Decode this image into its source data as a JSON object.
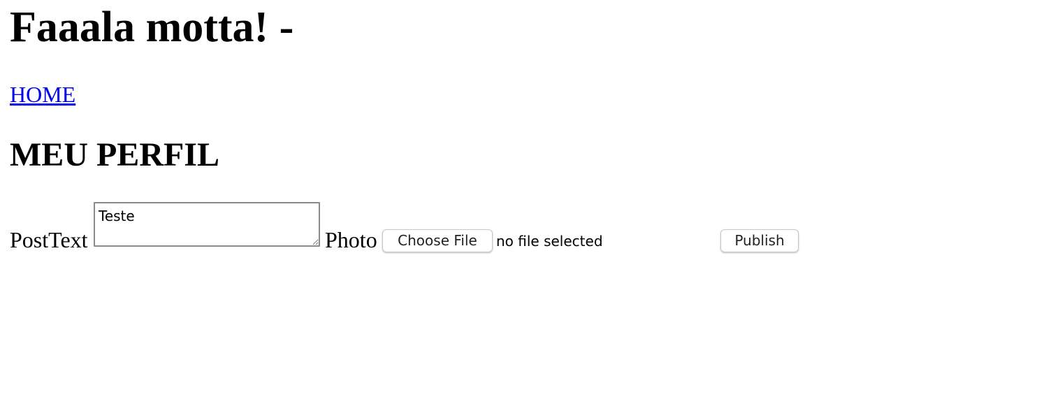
{
  "header": {
    "greeting": "Faaala motta! -"
  },
  "nav": {
    "home_label": "HOME"
  },
  "main": {
    "section_title": "MEU PERFIL",
    "form": {
      "post_text_label": "PostText",
      "post_text_value": "Teste",
      "photo_label": "Photo",
      "choose_file_label": "Choose File",
      "file_status": "no file selected",
      "publish_label": "Publish"
    }
  },
  "colors": {
    "link": "#0000ee",
    "text": "#000000",
    "background": "#ffffff"
  }
}
